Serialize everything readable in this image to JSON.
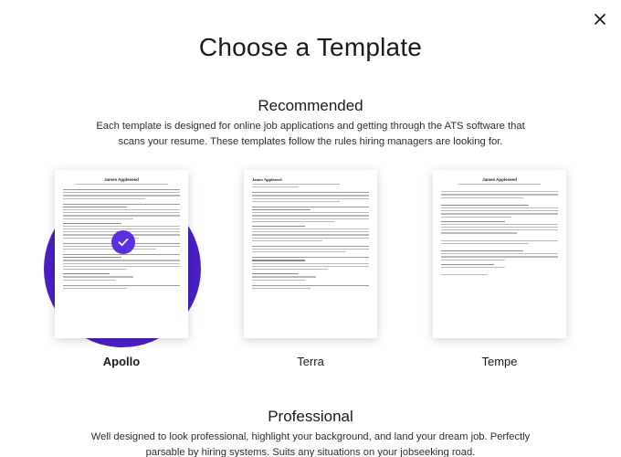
{
  "header": {
    "title": "Choose a Template",
    "close_label": "Close"
  },
  "recommended": {
    "heading": "Recommended",
    "description": "Each template is designed for online job applications and getting through the ATS software that scans your resume. These templates follow the rules hiring managers are looking for."
  },
  "templates": [
    {
      "name": "Apollo",
      "selected": true,
      "resume_name": "James Appleseed"
    },
    {
      "name": "Terra",
      "selected": false,
      "resume_name": "James Appleseed"
    },
    {
      "name": "Tempe",
      "selected": false,
      "resume_name": "James Appleseed"
    }
  ],
  "professional": {
    "heading": "Professional",
    "description": "Well designed to look professional, highlight your background, and land your dream job. Perfectly parsable by hiring systems. Suits any situations on your jobseeking road."
  },
  "colors": {
    "accent": "#4b1fc7",
    "check": "#5b2fe0"
  },
  "icons": {
    "close": "close-icon",
    "check": "checkmark-icon"
  }
}
